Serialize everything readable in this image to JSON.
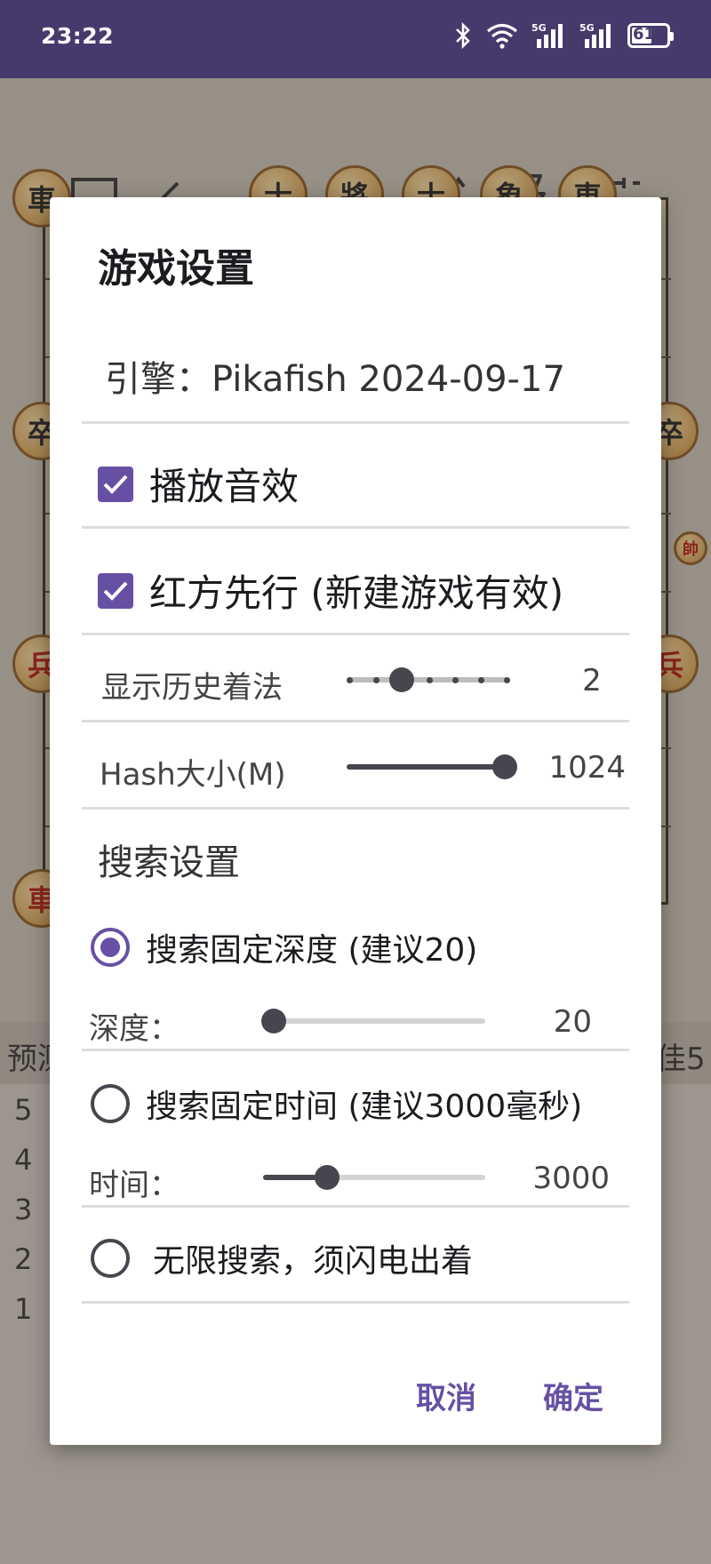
{
  "status_bar": {
    "time": "23:22",
    "icons": [
      "bluetooth-icon",
      "wifi-icon",
      "5g-signal-icon",
      "5g-signal-icon",
      "battery-icon"
    ],
    "battery_level": "61",
    "signal_label": "5G"
  },
  "toolbar": {
    "icons": [
      "laptop-icon",
      "back-arrow-icon",
      "forward-arrow-icon",
      "play-icon",
      "branch-icon",
      "flash-icon",
      "tune-icon"
    ]
  },
  "background": {
    "left_label": "预测",
    "right_label": "佳5",
    "row_numbers": [
      "5",
      "4",
      "3",
      "2",
      "1"
    ],
    "pieces": {
      "che": "車",
      "zu": "卒",
      "bing": "兵",
      "shuai": "帥",
      "shi": "士",
      "jiang": "將",
      "xiang": "象"
    }
  },
  "dialog": {
    "title": "游戏设置",
    "engine": "引擎：Pikafish 2024-09-17",
    "sound_checkbox": {
      "label": "播放音效",
      "checked": true
    },
    "red_first_checkbox": {
      "label": "红方先行 (新建游戏有效)",
      "checked": true
    },
    "history_slider": {
      "label": "显示历史着法",
      "value": "2",
      "min": 0,
      "max": 6,
      "current": 2
    },
    "hash_slider": {
      "label": "Hash大小(M)",
      "value": "1024",
      "fraction": 1.0
    },
    "search_section": "搜索设置",
    "radio_depth": {
      "label": "搜索固定深度 (建议20)",
      "selected": true
    },
    "depth_slider": {
      "label": "深度：",
      "value": "20",
      "fraction": 0.0
    },
    "radio_time": {
      "label": "搜索固定时间 (建议3000毫秒)",
      "selected": false
    },
    "time_slider": {
      "label": "时间：",
      "value": "3000",
      "fraction": 0.29
    },
    "radio_infinite": {
      "label": "无限搜索，须闪电出着",
      "selected": false
    },
    "cancel": "取消",
    "confirm": "确定"
  },
  "colors": {
    "accent": "#6750a4",
    "status_bar": "#463a6c"
  }
}
